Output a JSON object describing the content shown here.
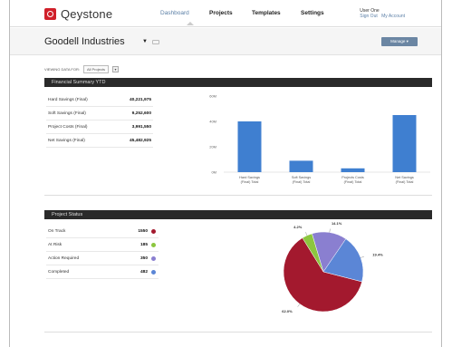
{
  "app": {
    "name": "Qeystone"
  },
  "nav": {
    "items": [
      "Dashboard",
      "Projects",
      "Templates",
      "Settings"
    ],
    "active": "Dashboard"
  },
  "user": {
    "name": "User One",
    "sign_out": "Sign Out",
    "my_account": "My Account"
  },
  "header": {
    "company": "Goodell Industries",
    "manage_label": "Manage ▾"
  },
  "viewing": {
    "label": "VIEWING DATA FOR:",
    "selected": "All Projects",
    "button": "▾"
  },
  "financial": {
    "title": "Financial Summary YTD",
    "rows": [
      {
        "label": "Hard Savings (Final)",
        "value": "40,221,975"
      },
      {
        "label": "Soft Savings (Final)",
        "value": "9,252,600"
      },
      {
        "label": "Project Costs (Final)",
        "value": "3,991,550"
      },
      {
        "label": "Net Savings (Final)",
        "value": "45,482,925"
      }
    ]
  },
  "project_status": {
    "title": "Project Status",
    "rows": [
      {
        "label": "On Track",
        "value": "1550",
        "color": "#a3192e"
      },
      {
        "label": "At Risk",
        "value": "185",
        "color": "#8cc63f"
      },
      {
        "label": "Action Required",
        "value": "350",
        "color": "#8a7fd0"
      },
      {
        "label": "Completed",
        "value": "482",
        "color": "#5b86d6"
      }
    ]
  },
  "chart_data": [
    {
      "type": "bar",
      "categories": [
        "Hard Savings (Final) Total",
        "Soft Savings (Final) Total",
        "Projects Costs (Final) Total",
        "Net Savings (Final) Total"
      ],
      "values": [
        40,
        9,
        3,
        45
      ],
      "ytick_labels": [
        "60M",
        "40M",
        "20M",
        "0M"
      ],
      "ylim": [
        0,
        60
      ],
      "bar_color": "#3f7fd0"
    },
    {
      "type": "pie",
      "slices": [
        {
          "label": "62.0%",
          "value": 62.0,
          "color": "#a3192e"
        },
        {
          "label": "4.2%",
          "value": 4.2,
          "color": "#8cc63f"
        },
        {
          "label": "14.1%",
          "value": 14.1,
          "color": "#8a7fd0"
        },
        {
          "label": "19.4%",
          "value": 19.4,
          "color": "#5b86d6"
        }
      ]
    }
  ]
}
